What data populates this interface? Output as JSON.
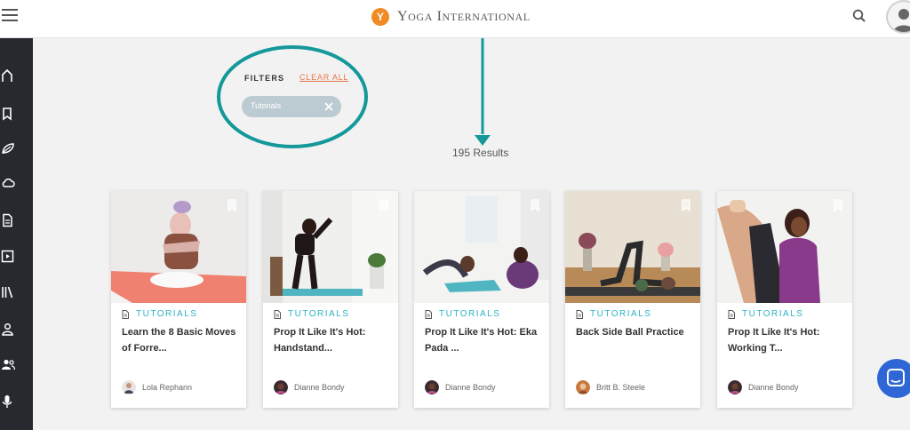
{
  "header": {
    "brand_logo_letter": "Y",
    "brand_name_first_initial": "Y",
    "brand_name_first_rest": "OGA",
    "brand_name_second_initial": "I",
    "brand_name_second_rest": "NTERNATIONAL"
  },
  "sidebar": {
    "items": [
      {
        "icon": "home-icon"
      },
      {
        "icon": "bookmark-icon"
      },
      {
        "icon": "leaf-icon"
      },
      {
        "icon": "cloud-icon"
      },
      {
        "icon": "article-icon"
      },
      {
        "icon": "video-icon"
      },
      {
        "icon": "library-icon"
      },
      {
        "icon": "person-icon"
      },
      {
        "icon": "people-icon"
      },
      {
        "icon": "microphone-icon"
      }
    ]
  },
  "filters": {
    "label": "FILTERS",
    "clear_all": "CLEAR ALL",
    "active_chip": "Tutorials"
  },
  "results": {
    "count_text": "195 Results"
  },
  "cards": [
    {
      "type": "TUTORIALS",
      "title": "Learn the 8 Basic Moves of Forre...",
      "author": "Lola Rephann"
    },
    {
      "type": "TUTORIALS",
      "title": "Prop It Like It's Hot: Handstand...",
      "author": "Dianne Bondy"
    },
    {
      "type": "TUTORIALS",
      "title": "Prop It Like It's Hot: Eka Pada ...",
      "author": "Dianne Bondy"
    },
    {
      "type": "TUTORIALS",
      "title": "Back Side Ball Practice",
      "author": "Britt B. Steele"
    },
    {
      "type": "TUTORIALS",
      "title": "Prop It Like It's Hot: Working T...",
      "author": "Dianne Bondy"
    }
  ],
  "colors": {
    "accent_teal": "#2fb3c6",
    "annotation_teal": "#14989a",
    "clear_all_orange": "#e8734a",
    "brand_orange": "#f08a24",
    "sidebar_bg": "#262a2f",
    "chat_blue": "#2f66d6"
  }
}
